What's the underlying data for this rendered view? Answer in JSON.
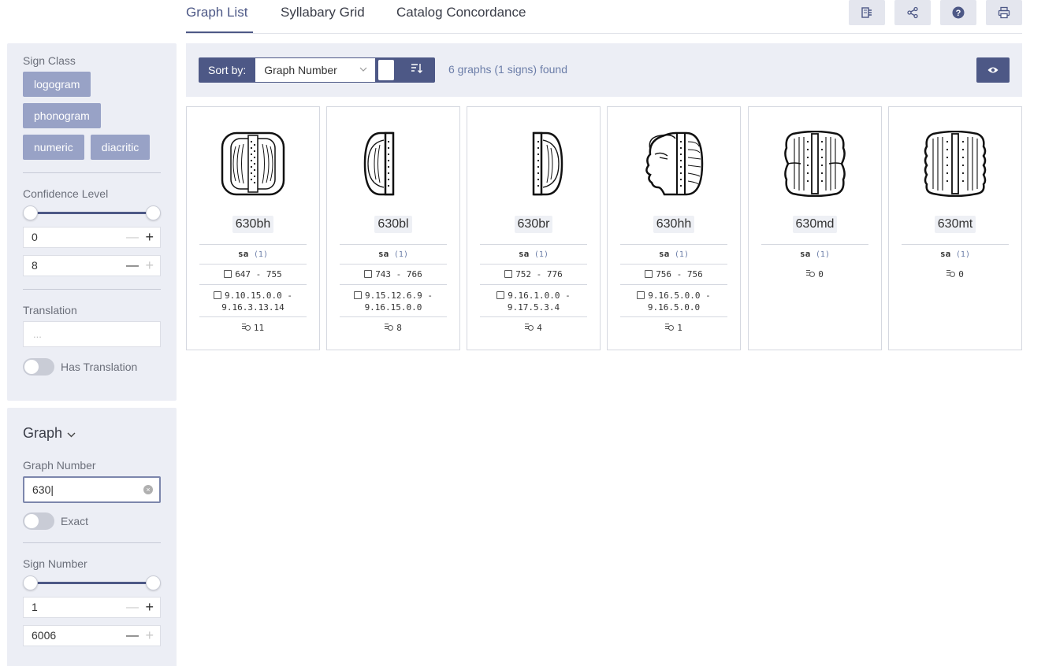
{
  "tabs": [
    {
      "label": "Graph List",
      "active": true
    },
    {
      "label": "Syllabary Grid",
      "active": false
    },
    {
      "label": "Catalog Concordance",
      "active": false
    }
  ],
  "tool_buttons": [
    "book-icon",
    "share-icon",
    "help-icon",
    "print-icon"
  ],
  "sidebar": {
    "sign_class": {
      "label": "Sign Class",
      "chips": [
        "logogram",
        "phonogram",
        "numeric",
        "diacritic"
      ]
    },
    "confidence": {
      "label": "Confidence Level",
      "min_value": "0",
      "max_value": "8"
    },
    "translation": {
      "label": "Translation",
      "placeholder": "...",
      "toggle_label": "Has Translation"
    },
    "graph": {
      "heading": "Graph",
      "graph_number_label": "Graph Number",
      "graph_number_value": "630",
      "exact_label": "Exact",
      "sign_number_label": "Sign Number",
      "sign_min": "1",
      "sign_max": "6006"
    }
  },
  "toolbar": {
    "sort_label": "Sort by:",
    "sort_value": "Graph Number",
    "found_text": "6 graphs (1 signs) found"
  },
  "cards": [
    {
      "number": "630bh",
      "reading": "sa",
      "reading_count": "(1)",
      "dates": "647 - 755",
      "lc_start": "9.10.15.0.0 -",
      "lc_end": "9.16.3.13.14",
      "occurrences": "11",
      "glyph": "full"
    },
    {
      "number": "630bl",
      "reading": "sa",
      "reading_count": "(1)",
      "dates": "743 - 766",
      "lc_start": "9.15.12.6.9 -",
      "lc_end": "9.16.15.0.0",
      "occurrences": "8",
      "glyph": "left"
    },
    {
      "number": "630br",
      "reading": "sa",
      "reading_count": "(1)",
      "dates": "752 - 776",
      "lc_start": "9.16.1.0.0 -",
      "lc_end": "9.17.5.3.4",
      "occurrences": "4",
      "glyph": "right"
    },
    {
      "number": "630hh",
      "reading": "sa",
      "reading_count": "(1)",
      "dates": "756 - 756",
      "lc_start": "9.16.5.0.0 -",
      "lc_end": "9.16.5.0.0",
      "occurrences": "1",
      "glyph": "head"
    },
    {
      "number": "630md",
      "reading": "sa",
      "reading_count": "(1)",
      "dates": "",
      "lc_start": "",
      "lc_end": "",
      "occurrences": "0",
      "glyph": "wide"
    },
    {
      "number": "630mt",
      "reading": "sa",
      "reading_count": "(1)",
      "dates": "",
      "lc_start": "",
      "lc_end": "",
      "occurrences": "0",
      "glyph": "wide2"
    }
  ]
}
